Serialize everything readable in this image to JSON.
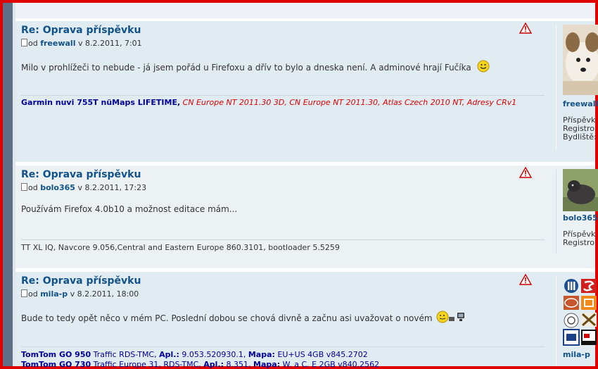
{
  "posts": [
    {
      "title": "Re: Oprava příspěvku",
      "meta_prefix": "od",
      "author": "freewall",
      "date": "v 8.2.2011, 7:01",
      "content": "Milo v prohlížeči to nebude - já jsem pořád u Firefoxu a dřív to bylo a dneska není. A adminové hrají Fučíka",
      "signature_blue": "Garmin nuvi 755T nüMaps LIFETIME,",
      "signature_red": "CN Europe NT 2011.30 3D, CN Europe NT 2011.30, Atlas Czech 2010 NT, Adresy CRv1",
      "profile_name": "freewall",
      "profile_lines": [
        "Příspěvk",
        "Registro",
        "Bydliště:"
      ]
    },
    {
      "title": "Re: Oprava příspěvku",
      "meta_prefix": "od",
      "author": "bolo365",
      "date": "v 8.2.2011, 17:23",
      "content": "Používám Firefox 4.0b10 a možnost editace mám...",
      "signature": "TT XL IQ, Navcore 9.056,Central and Eastern Europe 860.3101, bootloader 5.5259",
      "profile_name": "bolo365",
      "profile_lines": [
        "Příspěvk",
        "Registro"
      ]
    },
    {
      "title": "Re: Oprava příspěvku",
      "meta_prefix": "od",
      "author": "mila-p",
      "date": "v 8.2.2011, 18:00",
      "content": "Bude to tedy opět něco v mém PC. Poslední dobou se chová divně a začnu asi uvažovat o novém",
      "sig1_device": "TomTom GO 950",
      "sig1_traffic": "Traffic RDS-TMC,",
      "sig1_apl_label": "Apl.:",
      "sig1_apl": "9.053.520930.1,",
      "sig1_mapa_label": "Mapa:",
      "sig1_mapa": "EU+US 4GB v845.2702",
      "sig2_device": "TomTom GO 730",
      "sig2_traffic": "Traffic Europe 31, RDS-TMC,",
      "sig2_apl_label": "Apl.:",
      "sig2_apl": "8.351,",
      "sig2_mapa_label": "Mapa:",
      "sig2_mapa": "W. a C. E 2GB v840.2562",
      "profile_name": "mila-p"
    }
  ],
  "colors": {
    "frame": "#e00000",
    "title": "#105289",
    "signature_blue": "#000099",
    "signature_red": "#e00000"
  },
  "icons": {
    "report": "report-warning-icon",
    "post_doc": "post-doc-icon",
    "smiley": "smiley-icon"
  }
}
